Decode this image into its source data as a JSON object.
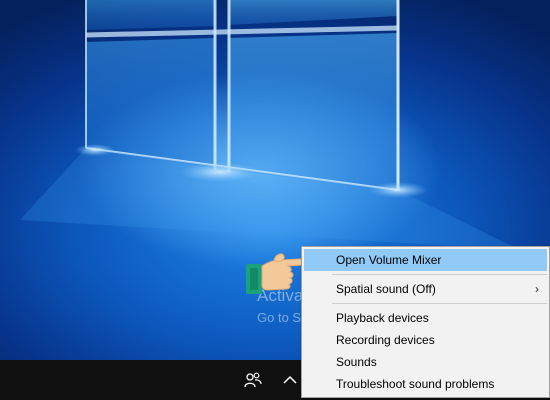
{
  "watermark": {
    "title": "Activate Windows",
    "subtitle": "Go to Settings to activate Windows."
  },
  "context_menu": {
    "items": [
      {
        "label": "Open Volume Mixer",
        "highlighted": true
      },
      {
        "label": "Spatial sound (Off)",
        "has_submenu": true,
        "arrow": "›"
      },
      {
        "label": "Playback devices"
      },
      {
        "label": "Recording devices"
      },
      {
        "label": "Sounds"
      },
      {
        "label": "Troubleshoot sound problems"
      }
    ]
  },
  "taskbar": {
    "icons": [
      "people-icon",
      "chevron-up-icon"
    ]
  },
  "colors": {
    "menu_bg": "#f2f2f2",
    "highlight": "#91c9f7",
    "taskbar": "#101010",
    "wallpaper": "#0c58bd"
  }
}
